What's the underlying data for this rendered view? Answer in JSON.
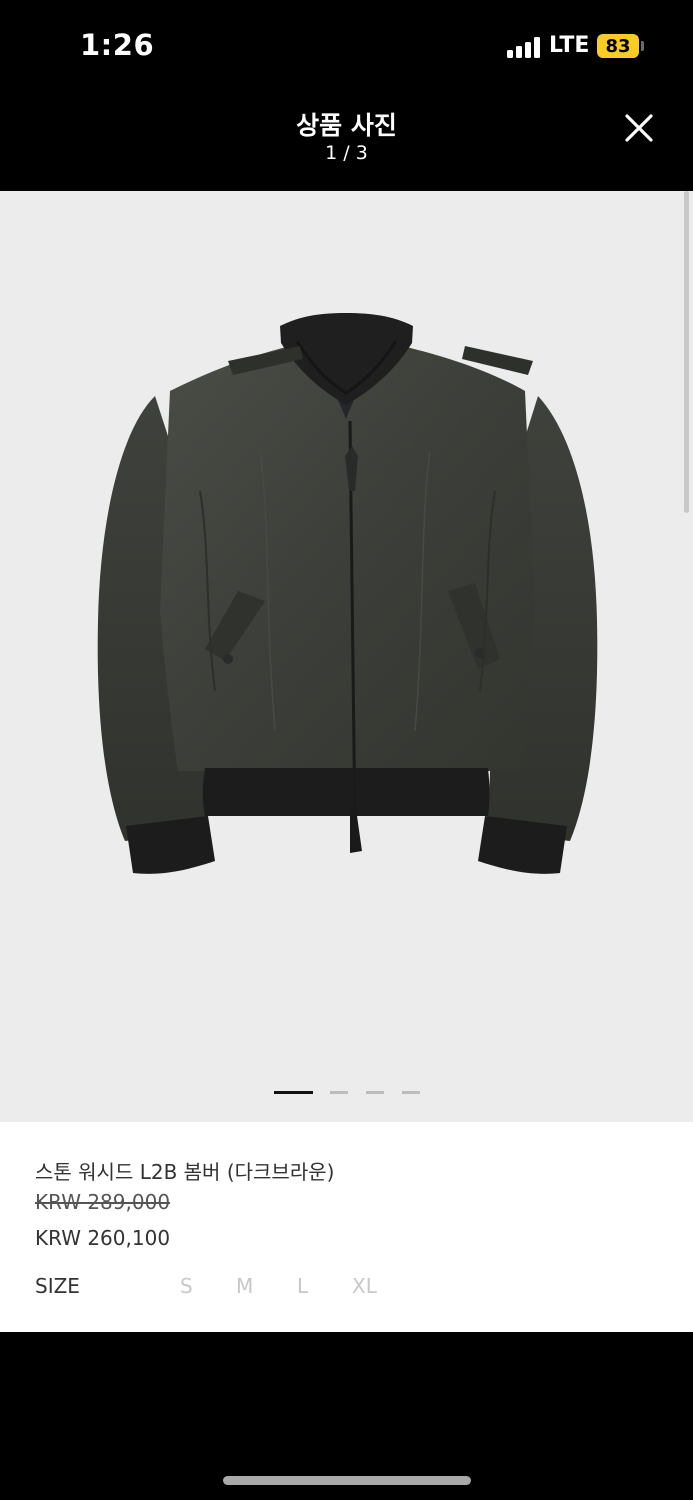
{
  "status_bar": {
    "time": "1:26",
    "network": "LTE",
    "battery": "83",
    "battery_color": "#f7cd24"
  },
  "header": {
    "title": "상품 사진",
    "counter": "1 / 3",
    "close_icon": "close-icon"
  },
  "gallery": {
    "image": "dark-brown-bomber-jacket-photo",
    "background_color": "#ececec",
    "pages": [
      {
        "active": true
      },
      {
        "active": false
      },
      {
        "active": false
      },
      {
        "active": false
      }
    ]
  },
  "product": {
    "name": "스톤 워시드 L2B 봄버 (다크브라운)",
    "original_price": "KRW 289,000",
    "sale_price": "KRW 260,100",
    "size_label": "SIZE",
    "sizes": [
      "S",
      "M",
      "L",
      "XL"
    ]
  }
}
